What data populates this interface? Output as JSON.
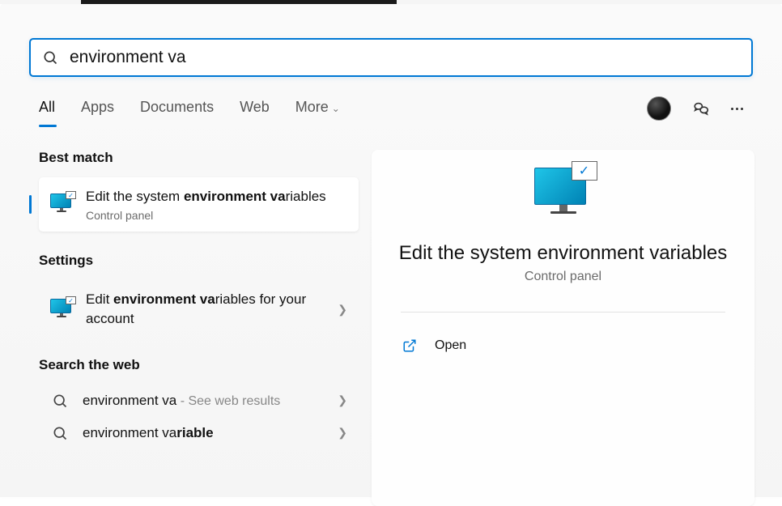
{
  "search": {
    "value": "environment va"
  },
  "tabs": {
    "all": "All",
    "apps": "Apps",
    "documents": "Documents",
    "web": "Web",
    "more": "More"
  },
  "sections": {
    "best_match": "Best match",
    "settings": "Settings",
    "search_web": "Search the web"
  },
  "results": {
    "best": {
      "prefix": "Edit the system ",
      "bold": "environment va",
      "suffix": "riables",
      "category": "Control panel"
    },
    "settings": {
      "prefix": "Edit ",
      "bold": "environment va",
      "suffix": "riables for your account"
    },
    "web1": {
      "text": "environment va",
      "suffix": " - See web results"
    },
    "web2": {
      "prefix": "environment va",
      "bold": "riable"
    }
  },
  "preview": {
    "title": "Edit the system environment variables",
    "category": "Control panel",
    "open": "Open"
  }
}
